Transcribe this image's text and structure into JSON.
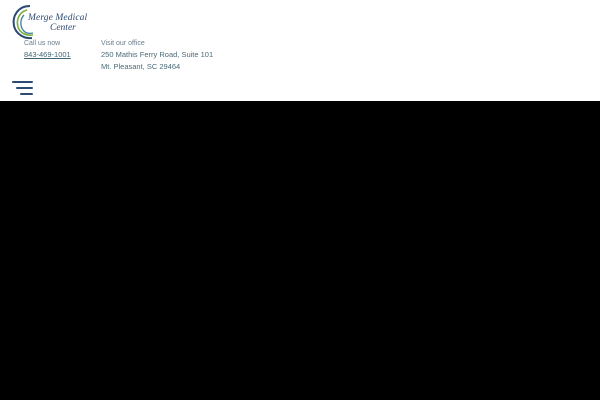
{
  "brand": {
    "name_line1": "Merge Medical",
    "name_line2": "Center",
    "colors": {
      "navy": "#2d4a73",
      "green": "#7cae3a",
      "teal": "#3e7fa0"
    }
  },
  "contact": {
    "call_label": "Call us now",
    "phone": "843-469-1001",
    "visit_label": "Visit our office",
    "address_line1": "250 Mathis Ferry Road, Suite 101",
    "address_line2": "Mt. Pleasant, SC 29464"
  },
  "nav": {
    "menu_icon": "hamburger-menu-icon"
  },
  "hero": {
    "background": "#000000"
  }
}
